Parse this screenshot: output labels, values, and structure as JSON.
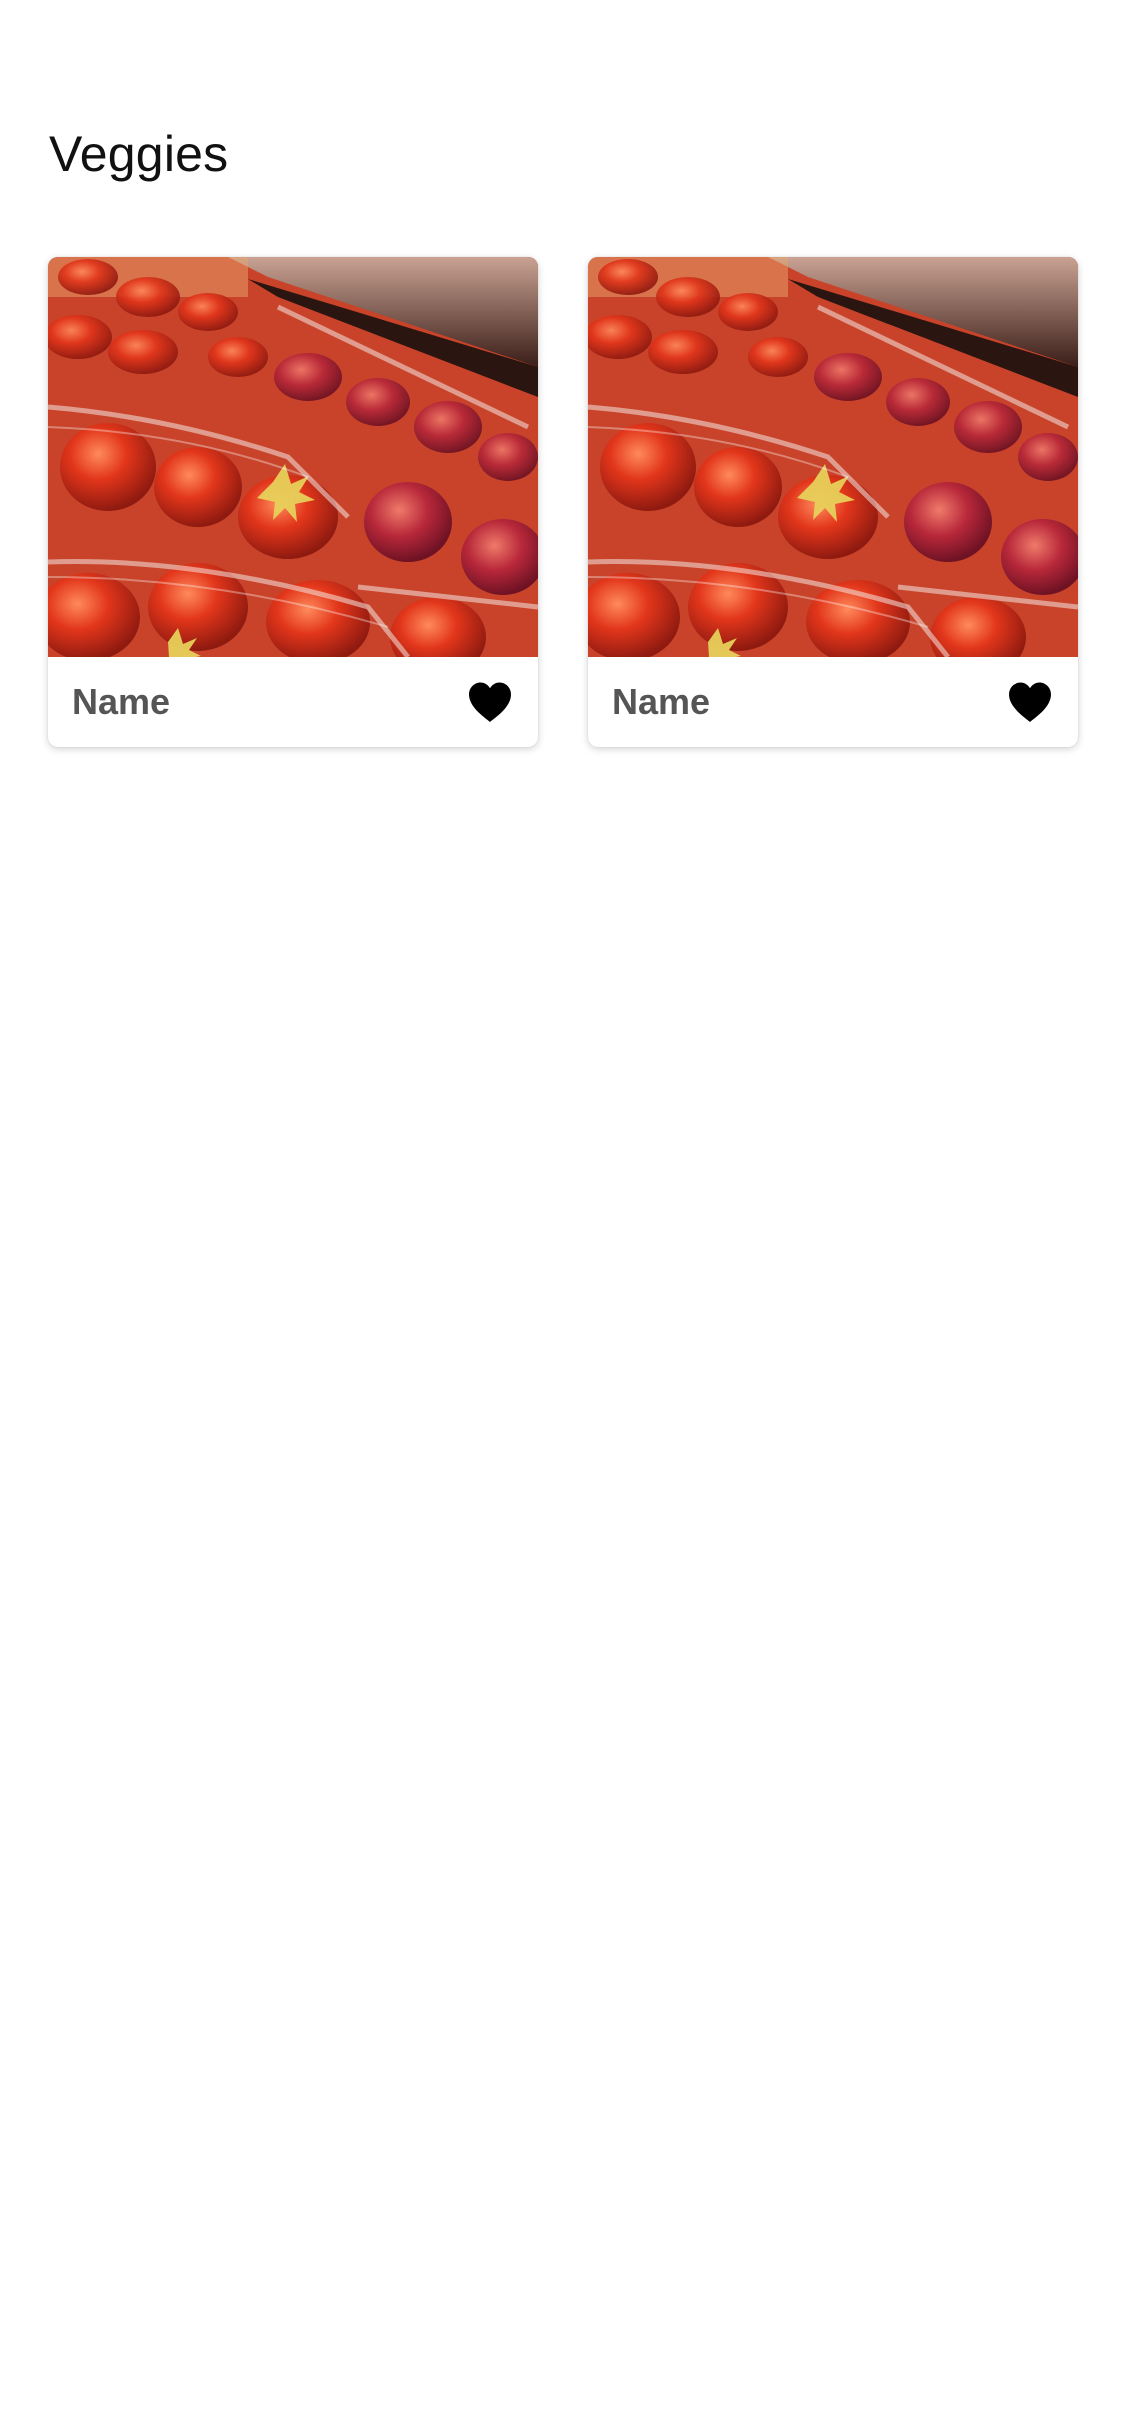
{
  "page": {
    "title": "Veggies"
  },
  "cards": [
    {
      "name": "Name",
      "image": "strawberries-in-plastic-punnets",
      "favorite_icon": "heart-filled-icon",
      "favorited": true
    },
    {
      "name": "Name",
      "image": "strawberries-in-plastic-punnets",
      "favorite_icon": "heart-filled-icon",
      "favorited": true
    }
  ],
  "colors": {
    "background": "#ffffff",
    "title": "#111111",
    "card_name": "#555555",
    "heart": "#000000"
  }
}
